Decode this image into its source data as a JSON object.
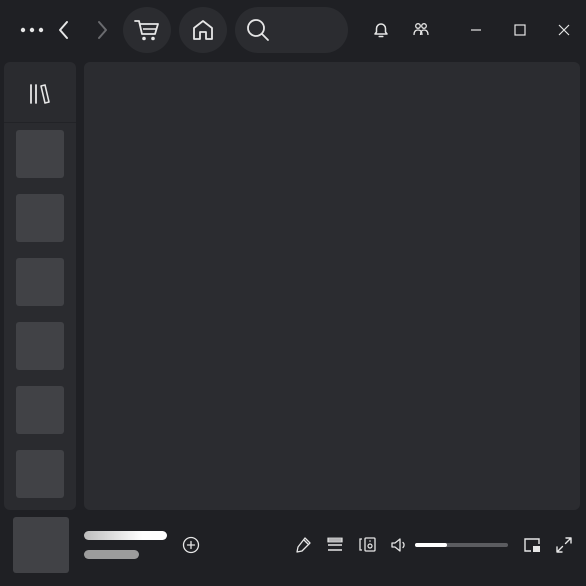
{
  "window": {
    "menu_icon": "more-horizontal-icon",
    "minimize_icon": "minimize-icon",
    "maximize_icon": "maximize-icon",
    "close_icon": "close-icon"
  },
  "topbar": {
    "back_icon": "chevron-left-icon",
    "forward_icon": "chevron-right-icon",
    "forward_enabled": false,
    "shop_icon": "cart-icon",
    "home_icon": "home-icon",
    "search_icon": "search-icon",
    "search_value": "",
    "notifications_icon": "bell-icon",
    "friends_icon": "people-icon"
  },
  "sidebar": {
    "library_icon": "library-icon",
    "items": [
      {
        "kind": "placeholder"
      },
      {
        "kind": "placeholder"
      },
      {
        "kind": "placeholder"
      },
      {
        "kind": "placeholder"
      },
      {
        "kind": "placeholder"
      },
      {
        "kind": "placeholder"
      }
    ]
  },
  "player": {
    "add_icon": "add-circle-icon",
    "lyrics_icon": "microphone-icon",
    "queue_icon": "queue-icon",
    "devices_icon": "connect-device-icon",
    "volume_icon": "volume-icon",
    "volume_level": 0.34,
    "miniplayer_icon": "miniplayer-icon",
    "fullscreen_icon": "fullscreen-icon"
  },
  "colors": {
    "background": "#1f2024",
    "panel": "#2b2c30",
    "tile": "#414246",
    "icon": "#d8d8d8"
  }
}
